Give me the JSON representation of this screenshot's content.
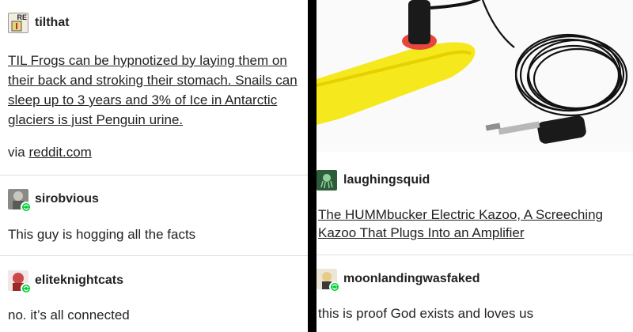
{
  "left": {
    "post1": {
      "username": "tilthat",
      "text": "TIL Frogs can be hypnotized by laying them on their back and stroking their stomach. Snails can sleep up to 3 years and 3% of Ice in Antarctic glaciers is just Penguin urine.",
      "via_prefix": "via ",
      "via_link": "reddit.com",
      "avatar_text": "RE"
    },
    "reblog1": {
      "username": "sirobvious",
      "text": "This guy is hogging all the facts"
    },
    "reblog2": {
      "username": "eliteknightcats",
      "text": "no. it’s all connected"
    }
  },
  "right": {
    "post1": {
      "username": "laughingsquid",
      "text": "The HUMMbucker Electric Kazoo, A Screeching Kazoo That Plugs Into an Amplifier"
    },
    "reblog1": {
      "username": "moonlandingwasfaked",
      "text": "this is proof God exists and loves us"
    }
  },
  "colors": {
    "reblog_badge": "#00cf35",
    "kazoo": "#f5e81c",
    "divider": "#dddddd"
  }
}
